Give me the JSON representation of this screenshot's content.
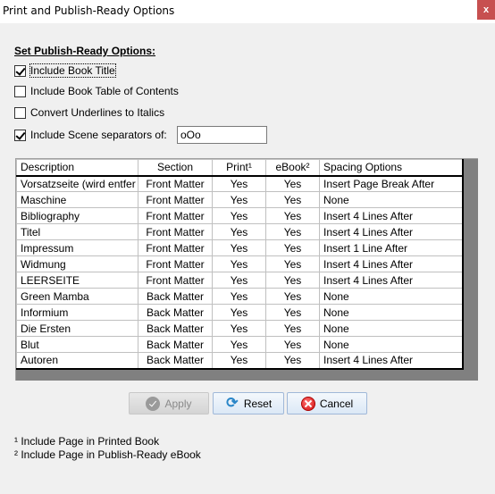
{
  "window": {
    "title": "Print and Publish-Ready Options",
    "close_label": "x"
  },
  "options": {
    "heading": "Set Publish-Ready Options:",
    "items": [
      {
        "label": "Include Book Title",
        "checked": true
      },
      {
        "label": "Include Book Table of Contents",
        "checked": false
      },
      {
        "label": "Convert Underlines to Italics",
        "checked": false
      },
      {
        "label": "Include Scene separators of:",
        "checked": true
      }
    ],
    "scene_separator_value": "oOo"
  },
  "table": {
    "columns": [
      "Description",
      "Section",
      "Print¹",
      "eBook²",
      "Spacing Options"
    ],
    "rows": [
      [
        "Vorsatzseite (wird entfer",
        "Front Matter",
        "Yes",
        "Yes",
        "Insert Page Break After"
      ],
      [
        "Maschine",
        "Front Matter",
        "Yes",
        "Yes",
        "None"
      ],
      [
        "Bibliography",
        "Front Matter",
        "Yes",
        "Yes",
        "Insert 4 Lines After"
      ],
      [
        "Titel",
        "Front Matter",
        "Yes",
        "Yes",
        "Insert 4 Lines After"
      ],
      [
        "Impressum",
        "Front Matter",
        "Yes",
        "Yes",
        "Insert 1 Line After"
      ],
      [
        "Widmung",
        "Front Matter",
        "Yes",
        "Yes",
        "Insert 4 Lines After"
      ],
      [
        "LEERSEITE",
        "Front Matter",
        "Yes",
        "Yes",
        "Insert 4 Lines After"
      ],
      [
        "Green Mamba",
        "Back Matter",
        "Yes",
        "Yes",
        "None"
      ],
      [
        "Informium",
        "Back Matter",
        "Yes",
        "Yes",
        "None"
      ],
      [
        "Die Ersten",
        "Back Matter",
        "Yes",
        "Yes",
        "None"
      ],
      [
        "Blut",
        "Back Matter",
        "Yes",
        "Yes",
        "None"
      ],
      [
        "Autoren",
        "Back Matter",
        "Yes",
        "Yes",
        "Insert 4 Lines After"
      ]
    ]
  },
  "buttons": {
    "apply": {
      "label": "Apply",
      "icon": "check-circle-icon",
      "enabled": false
    },
    "reset": {
      "label": "Reset",
      "icon": "refresh-icon",
      "enabled": true
    },
    "cancel": {
      "label": "Cancel",
      "icon": "cancel-x-icon",
      "enabled": true
    }
  },
  "footnotes": [
    "¹ Include Page in Printed Book",
    "² Include Page in Publish-Ready eBook"
  ]
}
